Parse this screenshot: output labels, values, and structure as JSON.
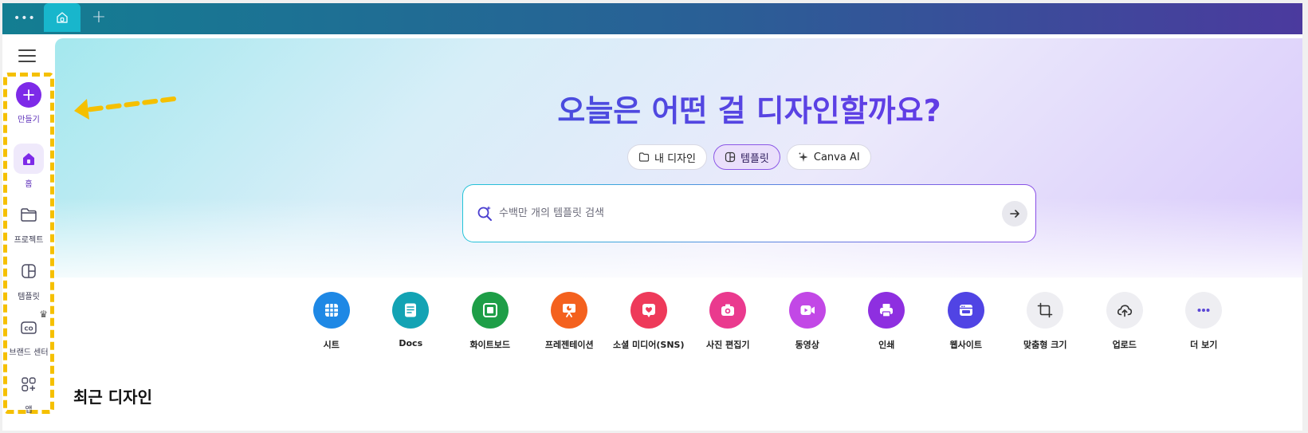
{
  "tabs": {
    "menu_dots": "•••",
    "new_tab": "+"
  },
  "sidebar": {
    "items": [
      {
        "label": "만들기",
        "icon": "plus-icon"
      },
      {
        "label": "홈",
        "icon": "home-icon"
      },
      {
        "label": "프로젝트",
        "icon": "folder-icon"
      },
      {
        "label": "템플릿",
        "icon": "template-icon"
      },
      {
        "label": "브랜드 센터",
        "icon": "brand-icon"
      },
      {
        "label": "앱",
        "icon": "apps-icon"
      }
    ]
  },
  "hero": {
    "headline": "오늘은 어떤 걸 디자인할까요?",
    "modes": [
      {
        "label": "내 디자인",
        "icon": "folder-icon"
      },
      {
        "label": "템플릿",
        "icon": "template-icon",
        "active": true
      },
      {
        "label": "Canva AI",
        "icon": "sparkle-icon"
      }
    ],
    "search_placeholder": "수백만 개의 템플릿 검색"
  },
  "categories": [
    {
      "label": "시트",
      "color": "#1e88e5"
    },
    {
      "label": "Docs",
      "color": "#13a3b4"
    },
    {
      "label": "화이트보드",
      "color": "#1e9e47"
    },
    {
      "label": "프레젠테이션",
      "color": "#f4611e"
    },
    {
      "label": "소셜 미디어(SNS)",
      "color": "#ee3a5a"
    },
    {
      "label": "사진 편집기",
      "color": "#ea3a8e"
    },
    {
      "label": "동영상",
      "color": "#c248e6"
    },
    {
      "label": "인쇄",
      "color": "#8e2fe0"
    },
    {
      "label": "웹사이트",
      "color": "#5044e4"
    },
    {
      "label": "맞춤형 크기",
      "color": "#eeeef2"
    },
    {
      "label": "업로드",
      "color": "#eeeef2"
    },
    {
      "label": "더 보기",
      "color": "#eeeef2"
    }
  ],
  "recent": {
    "title": "최근 디자인"
  }
}
